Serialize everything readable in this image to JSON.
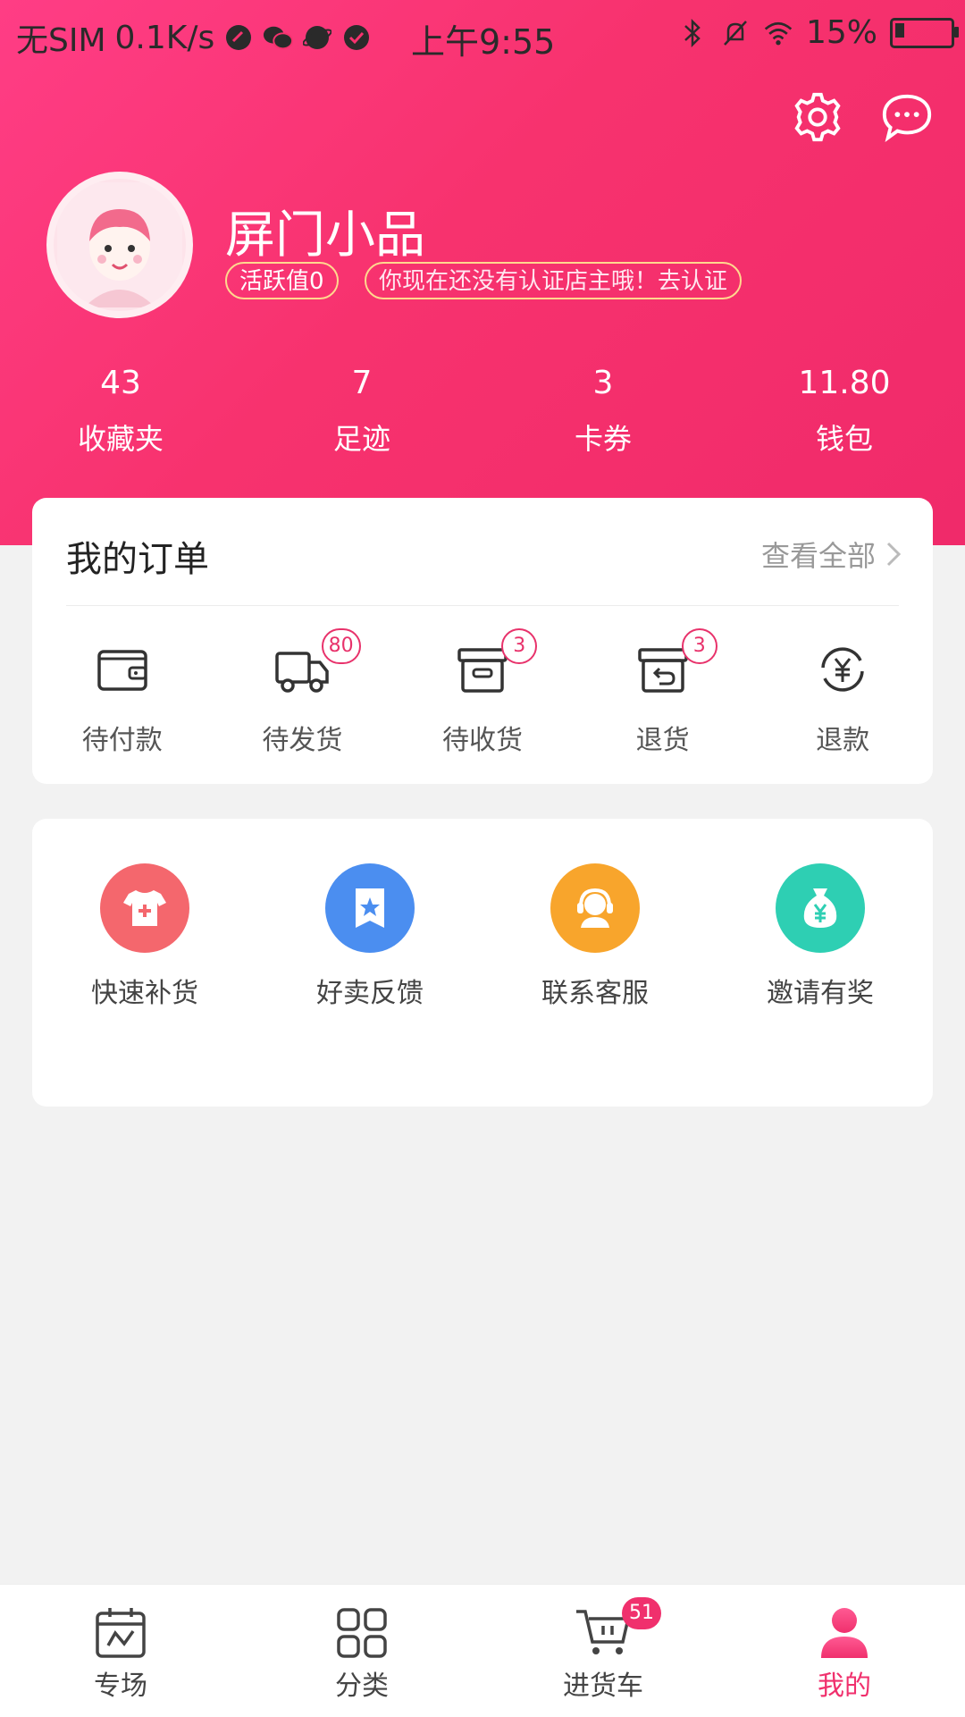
{
  "status_bar": {
    "carrier": "无SIM",
    "speed": "0.1K/s",
    "time": "上午9:55",
    "battery": "15%"
  },
  "header": {
    "username": "屏门小品",
    "activity_tag": "活跃值0",
    "cert_tag": "你现在还没有认证店主哦！去认证",
    "stats": [
      {
        "value": "43",
        "label": "收藏夹"
      },
      {
        "value": "7",
        "label": "足迹"
      },
      {
        "value": "3",
        "label": "卡券"
      },
      {
        "value": "11.80",
        "label": "钱包"
      }
    ]
  },
  "orders": {
    "title": "我的订单",
    "view_all": "查看全部",
    "items": [
      {
        "label": "待付款",
        "icon": "wallet-icon",
        "badge": ""
      },
      {
        "label": "待发货",
        "icon": "truck-icon",
        "badge": "80"
      },
      {
        "label": "待收货",
        "icon": "box-icon",
        "badge": "3"
      },
      {
        "label": "退货",
        "icon": "return-box-icon",
        "badge": "3"
      },
      {
        "label": "退款",
        "icon": "refund-yen-icon",
        "badge": ""
      }
    ]
  },
  "services": {
    "items": [
      {
        "label": "快速补货",
        "icon": "shirt-plus-icon",
        "color": "#f4676d"
      },
      {
        "label": "好卖反馈",
        "icon": "star-flag-icon",
        "color": "#4b8ef0"
      },
      {
        "label": "联系客服",
        "icon": "headset-icon",
        "color": "#f8a52c"
      },
      {
        "label": "邀请有奖",
        "icon": "money-bag-icon",
        "color": "#2ecfb3"
      }
    ]
  },
  "tabbar": {
    "items": [
      {
        "label": "专场",
        "icon": "calendar-chart-icon"
      },
      {
        "label": "分类",
        "icon": "grid-icon"
      },
      {
        "label": "进货车",
        "icon": "cart-icon",
        "badge": "51"
      },
      {
        "label": "我的",
        "icon": "person-icon"
      }
    ],
    "active_color": "#f0306d"
  },
  "colors": {
    "brand": "#f7326e",
    "badge_border": "#e8326b",
    "tag_border": "#ffd88e"
  }
}
